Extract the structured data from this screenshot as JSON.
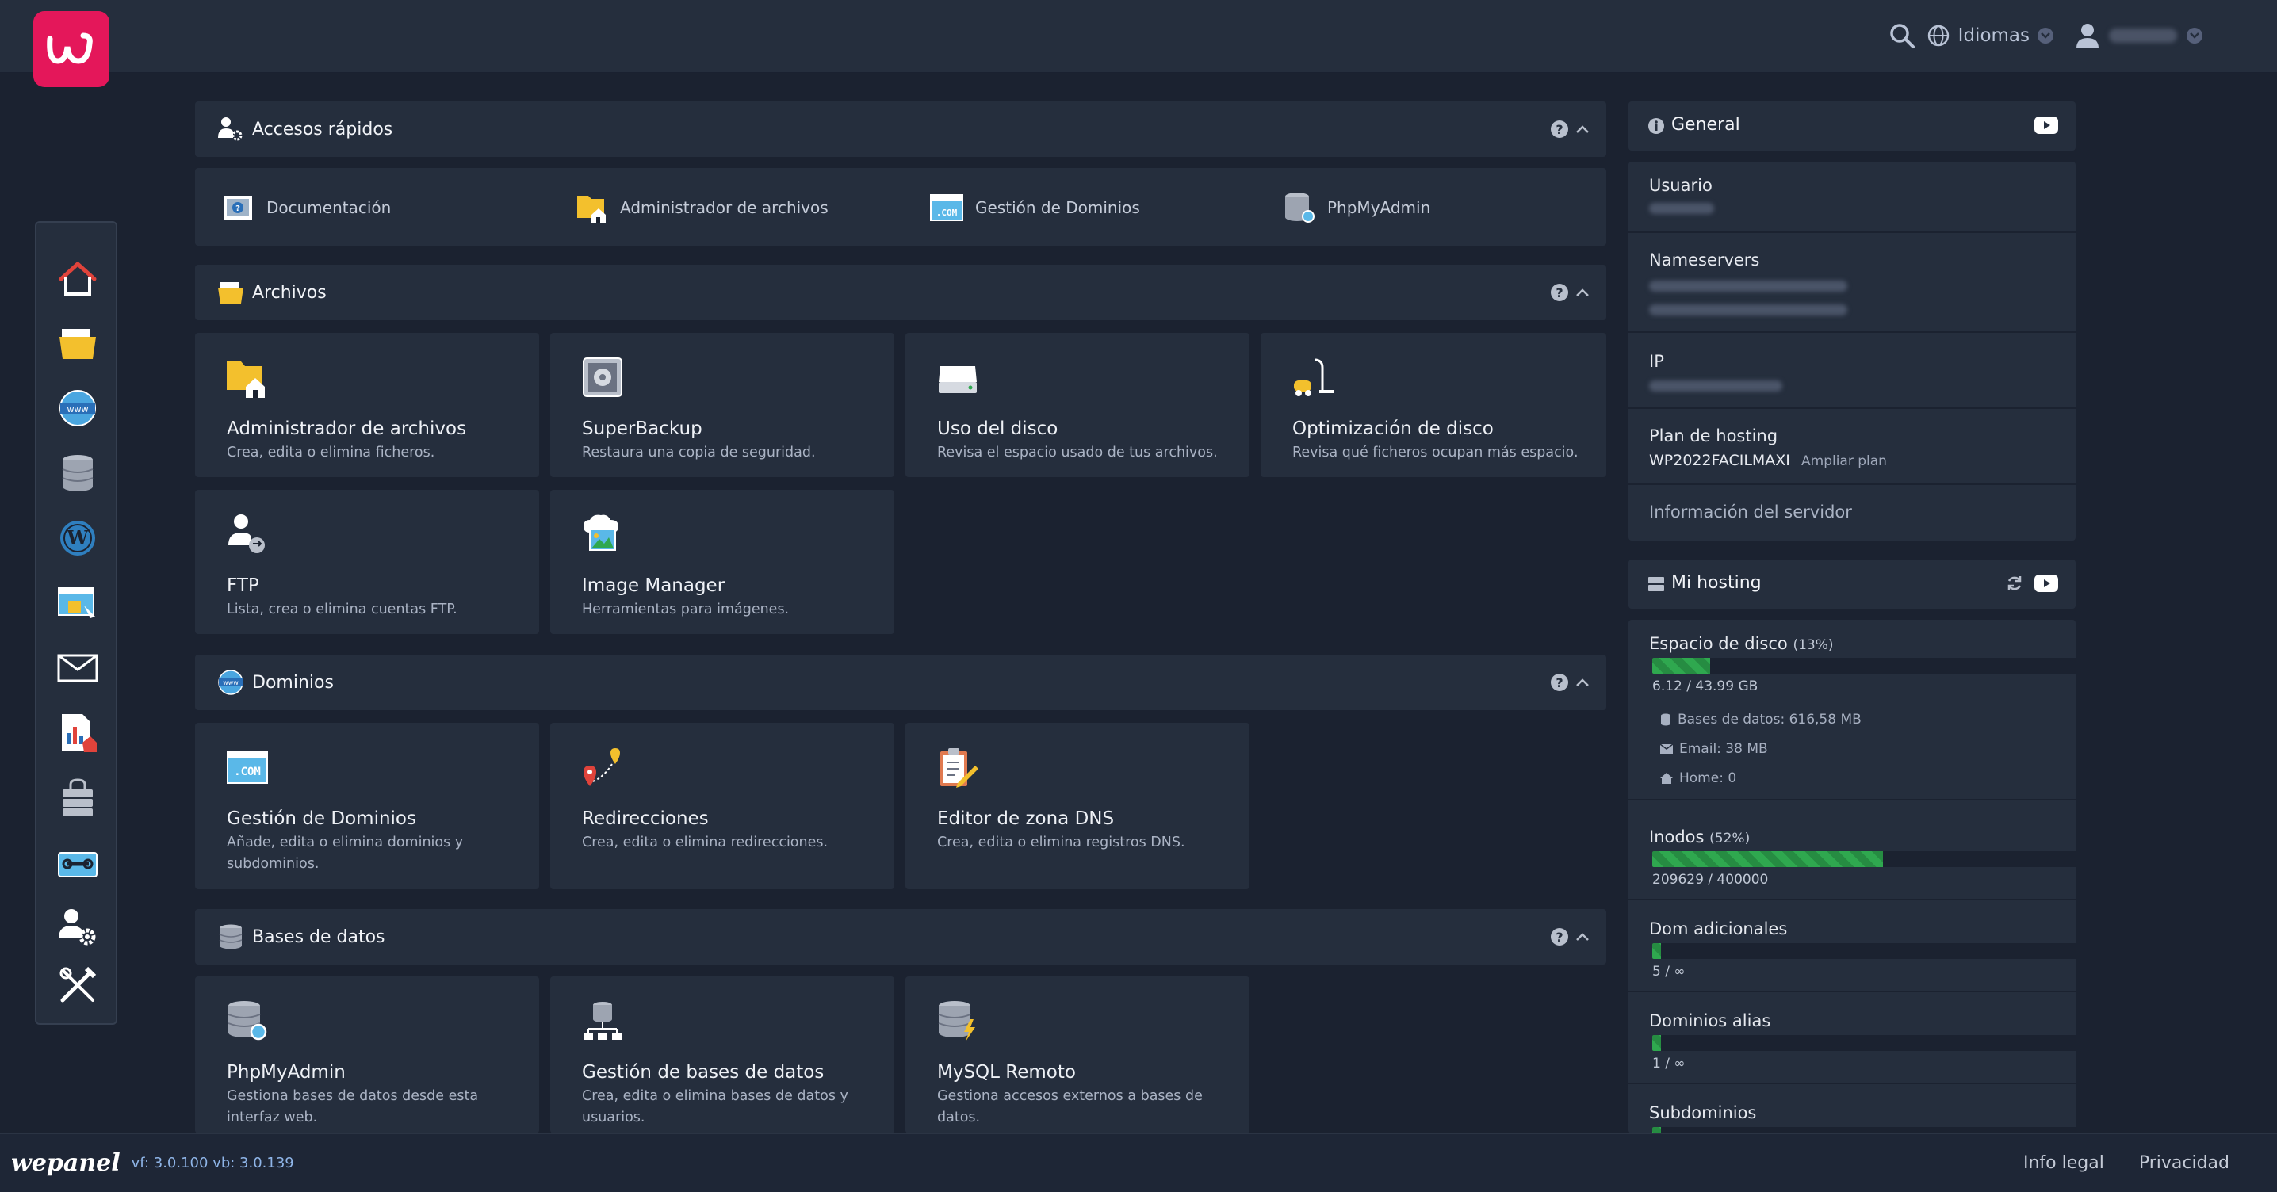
{
  "app": {
    "name": "wepanel"
  },
  "header": {
    "language_label": "Idiomas"
  },
  "quick_access": {
    "title": "Accesos rápidos",
    "help": "?",
    "items": [
      {
        "label": "Documentación"
      },
      {
        "label": "Administrador de archivos"
      },
      {
        "label": "Gestión de Dominios"
      },
      {
        "label": "PhpMyAdmin"
      }
    ]
  },
  "archivos": {
    "title": "Archivos",
    "help": "?",
    "cards": [
      {
        "title": "Administrador de archivos",
        "desc": "Crea, edita o elimina ficheros."
      },
      {
        "title": "SuperBackup",
        "desc": "Restaura una copia de seguridad."
      },
      {
        "title": "Uso del disco",
        "desc": "Revisa el espacio usado de tus archivos."
      },
      {
        "title": "Optimización de disco",
        "desc": "Revisa qué ficheros ocupan más espacio."
      },
      {
        "title": "FTP",
        "desc": "Lista, crea o elimina cuentas FTP."
      },
      {
        "title": "Image Manager",
        "desc": "Herramientas para imágenes."
      }
    ]
  },
  "dominios": {
    "title": "Dominios",
    "help": "?",
    "cards": [
      {
        "title": "Gestión de Dominios",
        "desc": "Añade, edita o elimina dominios y subdominios."
      },
      {
        "title": "Redirecciones",
        "desc": "Crea, edita o elimina redirecciones."
      },
      {
        "title": "Editor de zona DNS",
        "desc": "Crea, edita o elimina registros DNS."
      }
    ]
  },
  "bases_datos": {
    "title": "Bases de datos",
    "help": "?",
    "cards": [
      {
        "title": "PhpMyAdmin",
        "desc": "Gestiona bases de datos desde esta interfaz web."
      },
      {
        "title": "Gestión de bases de datos",
        "desc": "Crea, edita o elimina bases de datos y usuarios."
      },
      {
        "title": "MySQL Remoto",
        "desc": "Gestiona accesos externos a bases de datos."
      }
    ]
  },
  "general": {
    "title": "General",
    "usuario_label": "Usuario",
    "nameservers_label": "Nameservers",
    "ip_label": "IP",
    "plan_label": "Plan de hosting",
    "plan_value": "WP2022FACILMAXI",
    "plan_link": "Ampliar plan",
    "server_info_link": "Información del servidor"
  },
  "mi_hosting": {
    "title": "Mi hosting",
    "disk": {
      "label": "Espacio de disco",
      "pct_text": "(13%)",
      "fill_pct": 13,
      "usage": "6.12 / 43.99 GB",
      "db": "Bases de datos: 616,58 MB",
      "email": "Email: 38 MB",
      "home": "Home: 0"
    },
    "inodes": {
      "label": "Inodos",
      "pct_text": "(52%)",
      "fill_pct": 52,
      "usage": "209629 / 400000"
    },
    "dom_adicionales": {
      "label": "Dom adicionales",
      "fill_pct": 2,
      "usage": "5 / ∞"
    },
    "dominios_alias": {
      "label": "Dominios alias",
      "fill_pct": 2,
      "usage": "1 / ∞"
    },
    "subdominios": {
      "label": "Subdominios",
      "fill_pct": 2
    }
  },
  "footer": {
    "brand": "wepanel",
    "version": "vf: 3.0.100 vb: 3.0.139",
    "legal": "Info legal",
    "privacy": "Privacidad"
  },
  "colors": {
    "brand": "#e4175a",
    "panel": "#252e3d",
    "background": "#1b2230",
    "progress": "#2fa84f"
  }
}
